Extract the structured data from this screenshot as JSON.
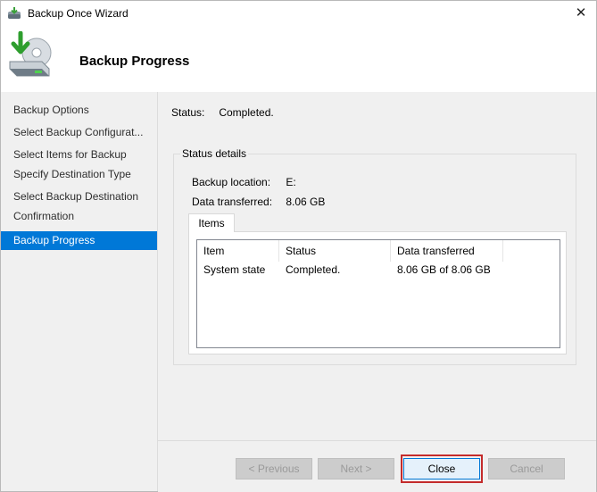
{
  "window": {
    "title": "Backup Once Wizard",
    "close_glyph": "✕"
  },
  "header": {
    "title": "Backup Progress",
    "icon": "backup-drive-icon"
  },
  "sidebar": {
    "items": [
      {
        "label": "Backup Options"
      },
      {
        "label": "Select Backup Configurat..."
      },
      {
        "label": "Select Items for Backup"
      },
      {
        "label": "Specify Destination Type"
      },
      {
        "label": "Select Backup Destination"
      },
      {
        "label": "Confirmation"
      },
      {
        "label": "Backup Progress",
        "active": true
      }
    ]
  },
  "status": {
    "label": "Status:",
    "value": "Completed."
  },
  "details": {
    "legend": "Status details",
    "location_label": "Backup location:",
    "location_value": "E:",
    "transferred_label": "Data transferred:",
    "transferred_value": "8.06 GB",
    "tab_label": "Items",
    "columns": [
      "Item",
      "Status",
      "Data transferred"
    ],
    "rows": [
      [
        "System state",
        "Completed.",
        "8.06 GB of 8.06 GB"
      ]
    ]
  },
  "buttons": {
    "previous": "< Previous",
    "next": "Next >",
    "close": "Close",
    "cancel": "Cancel"
  },
  "colors": {
    "accent": "#0078d7",
    "highlight": "#c42b2b",
    "panel": "#f0f0f0"
  }
}
